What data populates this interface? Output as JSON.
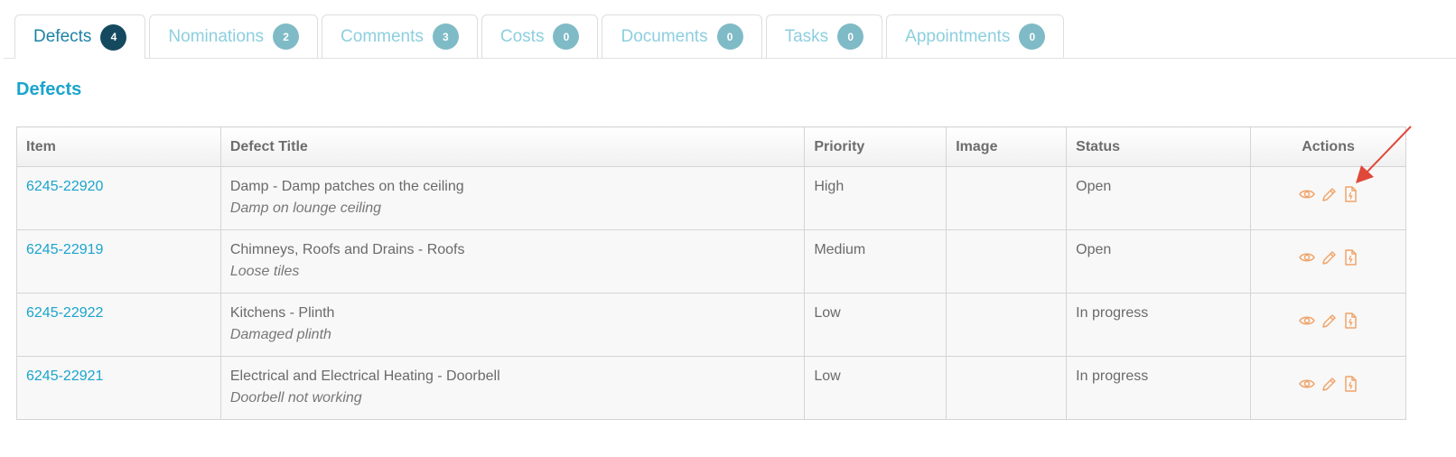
{
  "tabs": [
    {
      "label": "Defects",
      "count": "4"
    },
    {
      "label": "Nominations",
      "count": "2"
    },
    {
      "label": "Comments",
      "count": "3"
    },
    {
      "label": "Costs",
      "count": "0"
    },
    {
      "label": "Documents",
      "count": "0"
    },
    {
      "label": "Tasks",
      "count": "0"
    },
    {
      "label": "Appointments",
      "count": "0"
    }
  ],
  "section": {
    "title": "Defects"
  },
  "table": {
    "headers": {
      "item": "Item",
      "title": "Defect Title",
      "priority": "Priority",
      "image": "Image",
      "status": "Status",
      "actions": "Actions"
    },
    "rows": [
      {
        "item": "6245-22920",
        "title": "Damp - Damp patches on the ceiling",
        "description": "Damp on lounge ceiling",
        "priority": "High",
        "image": "",
        "status": "Open"
      },
      {
        "item": "6245-22919",
        "title": "Chimneys, Roofs and Drains - Roofs",
        "description": "Loose tiles",
        "priority": "Medium",
        "image": "",
        "status": "Open"
      },
      {
        "item": "6245-22922",
        "title": "Kitchens - Plinth",
        "description": "Damaged plinth",
        "priority": "Low",
        "image": "",
        "status": "In progress"
      },
      {
        "item": "6245-22921",
        "title": "Electrical and Electrical Heating - Doorbell",
        "description": "Doorbell not working",
        "priority": "Low",
        "image": "",
        "status": "In progress"
      }
    ]
  },
  "icons": {
    "view": "eye-icon",
    "edit": "pencil-icon",
    "report": "document-icon"
  },
  "colors": {
    "accent": "#1aa4cc",
    "active_tab": "#1c82a6",
    "badge_active": "#14495f",
    "badge": "#7fbbc6",
    "action_icon": "#f0a46a",
    "annotation_arrow": "#e0483a"
  }
}
